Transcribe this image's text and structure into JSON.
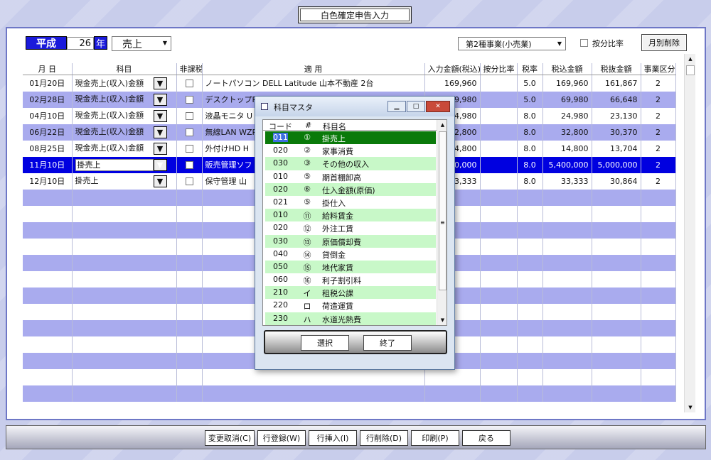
{
  "window_title": "白色確定申告入力",
  "header": {
    "era": "平成",
    "year": "26",
    "year_suffix": "年",
    "type_select": "売上",
    "business_select": "第2種事業(小売業)",
    "ratio_label": "按分比率",
    "month_delete": "月別削除"
  },
  "columns": [
    "月 日",
    "科目",
    "非課税",
    "適 用",
    "入力金額(税込)",
    "按分比率",
    "税率",
    "税込金額",
    "税抜金額",
    "事業区分"
  ],
  "rows": [
    {
      "date": "01月20日",
      "account": "現金売上(収入)金額",
      "desc": "ノートパソコン DELL Latitude 山本不動産 2台",
      "input": "169,960",
      "ratio": "",
      "tax": "5.0",
      "incl": "169,960",
      "excl": "161,867",
      "cat": "2"
    },
    {
      "date": "02月28日",
      "account": "現金売上(収入)金額",
      "desc": "デスクトップPC",
      "input": "69,980",
      "ratio": "",
      "tax": "5.0",
      "incl": "69,980",
      "excl": "66,648",
      "cat": "2"
    },
    {
      "date": "04月10日",
      "account": "現金売上(収入)金額",
      "desc": "液晶モニタ U",
      "input": "24,980",
      "ratio": "",
      "tax": "8.0",
      "incl": "24,980",
      "excl": "23,130",
      "cat": "2"
    },
    {
      "date": "06月22日",
      "account": "現金売上(収入)金額",
      "desc": "無線LAN WZR",
      "input": "32,800",
      "ratio": "",
      "tax": "8.0",
      "incl": "32,800",
      "excl": "30,370",
      "cat": "2"
    },
    {
      "date": "08月25日",
      "account": "現金売上(収入)金額",
      "desc": "外付けHD H",
      "input": "14,800",
      "ratio": "",
      "tax": "8.0",
      "incl": "14,800",
      "excl": "13,704",
      "cat": "2"
    },
    {
      "date": "11月10日",
      "account": "掛売上",
      "desc": "販売管理ソフ",
      "input": "00,000",
      "ratio": "",
      "tax": "8.0",
      "incl": "5,400,000",
      "excl": "5,000,000",
      "cat": "2"
    },
    {
      "date": "12月10日",
      "account": "掛売上",
      "desc": "保守管理 山",
      "input": "33,333",
      "ratio": "",
      "tax": "8.0",
      "incl": "33,333",
      "excl": "30,864",
      "cat": "2"
    }
  ],
  "dialog": {
    "title": "科目マスタ",
    "col_code": "コード",
    "col_num": "#",
    "col_name": "科目名",
    "items": [
      {
        "code": "011",
        "num": "①",
        "name": "掛売上"
      },
      {
        "code": "020",
        "num": "②",
        "name": "家事消費"
      },
      {
        "code": "030",
        "num": "③",
        "name": "その他の収入"
      },
      {
        "code": "010",
        "num": "⑤",
        "name": "期首棚卸高"
      },
      {
        "code": "020",
        "num": "⑥",
        "name": "仕入金額(原価)"
      },
      {
        "code": "021",
        "num": "⑤",
        "name": "掛仕入"
      },
      {
        "code": "010",
        "num": "⑪",
        "name": "給料賃金"
      },
      {
        "code": "020",
        "num": "⑫",
        "name": "外注工賃"
      },
      {
        "code": "030",
        "num": "⑬",
        "name": "原価償却費"
      },
      {
        "code": "040",
        "num": "⑭",
        "name": "貸倒金"
      },
      {
        "code": "050",
        "num": "⑮",
        "name": "地代家賃"
      },
      {
        "code": "060",
        "num": "⑯",
        "name": "利子割引料"
      },
      {
        "code": "210",
        "num": "イ",
        "name": "租税公課"
      },
      {
        "code": "220",
        "num": "ロ",
        "name": "荷造運賃"
      },
      {
        "code": "230",
        "num": "ハ",
        "name": "水道光熱費"
      }
    ],
    "select_btn": "選択",
    "close_btn": "終了"
  },
  "bottom_buttons": [
    "変更取消(C)",
    "行登録(W)",
    "行挿入(I)",
    "行削除(D)",
    "印刷(P)",
    "戻る"
  ]
}
